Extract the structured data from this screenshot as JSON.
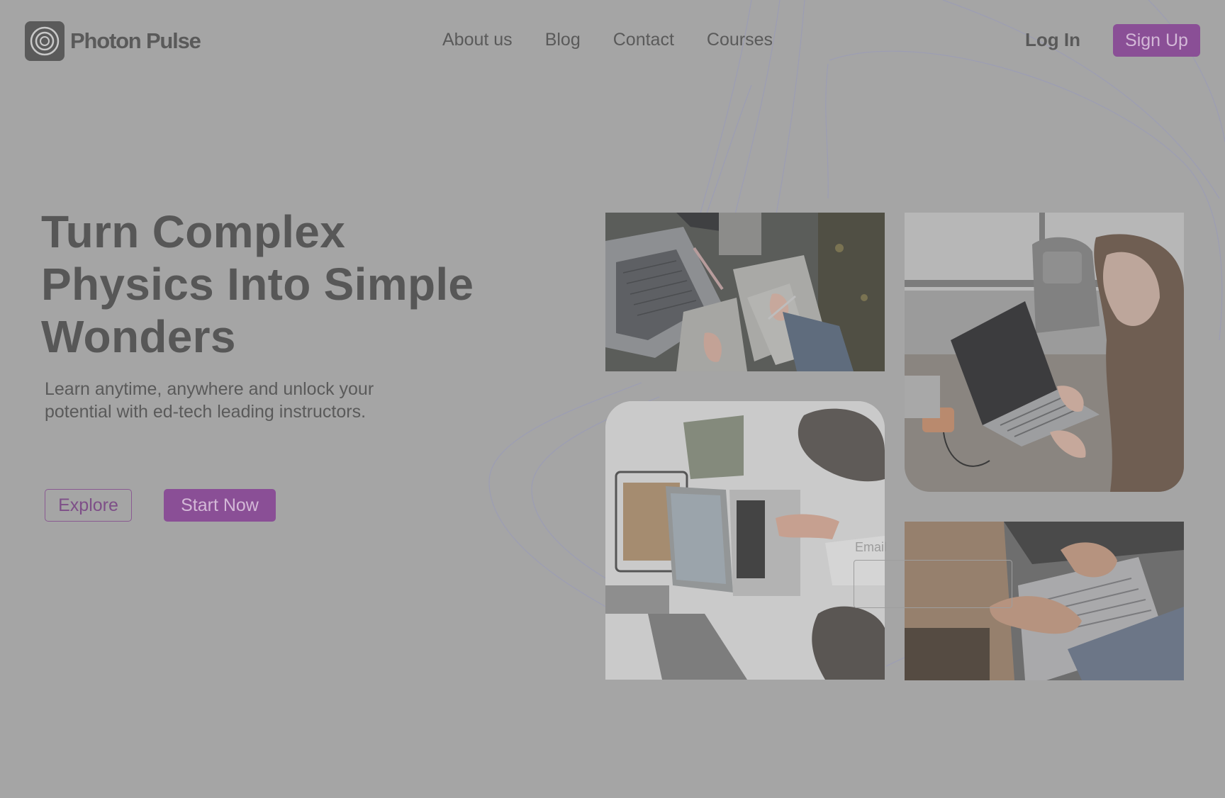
{
  "brand": {
    "name": "Photon Pulse",
    "logo_icon": "concentric-circles-icon"
  },
  "nav": {
    "items": [
      {
        "label": "About us"
      },
      {
        "label": "Blog"
      },
      {
        "label": "Contact"
      },
      {
        "label": "Courses"
      }
    ]
  },
  "auth": {
    "login_label": "Log In",
    "signup_label": "Sign Up"
  },
  "hero": {
    "title_lines": [
      "Turn Complex",
      "Physics Into Simple",
      "Wonders"
    ],
    "subtitle_lines": [
      "Learn anytime, anywhere and unlock your",
      "potential with ed-tech leading instructors."
    ],
    "explore_label": "Explore",
    "start_label": "Start Now"
  },
  "gallery": {
    "images": [
      {
        "name": "laptop-notes-desk-photo"
      },
      {
        "name": "woman-laptop-window-photo"
      },
      {
        "name": "students-table-laptop-photo"
      },
      {
        "name": "person-typing-laptop-photo"
      }
    ]
  },
  "ghost_form": {
    "label": "Email"
  },
  "colors": {
    "overlay_background": "#a5a5a5",
    "accent": "#8a4f96",
    "accent_text": "#d3b8d7",
    "text": "#585858"
  }
}
